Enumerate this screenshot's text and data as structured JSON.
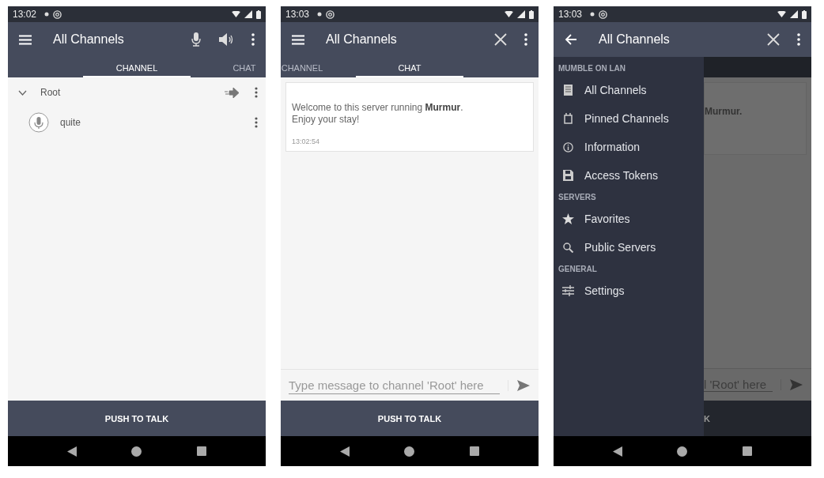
{
  "screens": [
    {
      "kind": "channels",
      "status_time": "13:02",
      "title": "All Channels",
      "tabs": [
        {
          "label": "CHANNEL",
          "selected": true
        },
        {
          "label": "CHAT",
          "selected": false
        }
      ],
      "tree": [
        {
          "name": "Root",
          "expanded": true,
          "children": [
            {
              "name": "quite"
            }
          ]
        }
      ],
      "push_to_talk": "PUSH TO TALK"
    },
    {
      "kind": "chat",
      "status_time": "13:03",
      "title": "All Channels",
      "tabs": [
        {
          "label": "CHANNEL",
          "selected": false
        },
        {
          "label": "CHAT",
          "selected": true
        }
      ],
      "message": {
        "lines": [
          "Welcome to this server running **Murmur**.",
          "Enjoy your stay!"
        ],
        "time": "13:02:54"
      },
      "input": {
        "placeholder": "Type message to channel 'Root' here"
      },
      "push_to_talk": "PUSH TO TALK"
    },
    {
      "kind": "drawer",
      "status_time": "13:03",
      "title": "All Channels",
      "drawer": [
        {
          "header": "MUMBLE ON LAN",
          "items": [
            {
              "label": "All Channels",
              "kind": "channels"
            },
            {
              "label": "Pinned Channels",
              "kind": "pinned"
            },
            {
              "label": "Information",
              "kind": "info"
            },
            {
              "label": "Access Tokens",
              "kind": "tokens"
            }
          ]
        },
        {
          "header": "SERVERS",
          "items": [
            {
              "label": "Favorites",
              "kind": "favorites"
            },
            {
              "label": "Public Servers",
              "kind": "search"
            }
          ]
        },
        {
          "header": "GENERAL",
          "items": [
            {
              "label": "Settings",
              "kind": "settings"
            }
          ]
        }
      ],
      "behind": {
        "message_fragment": "Murmur.",
        "input_fragment": "l 'Root' here",
        "button_fragment": "K"
      }
    }
  ]
}
